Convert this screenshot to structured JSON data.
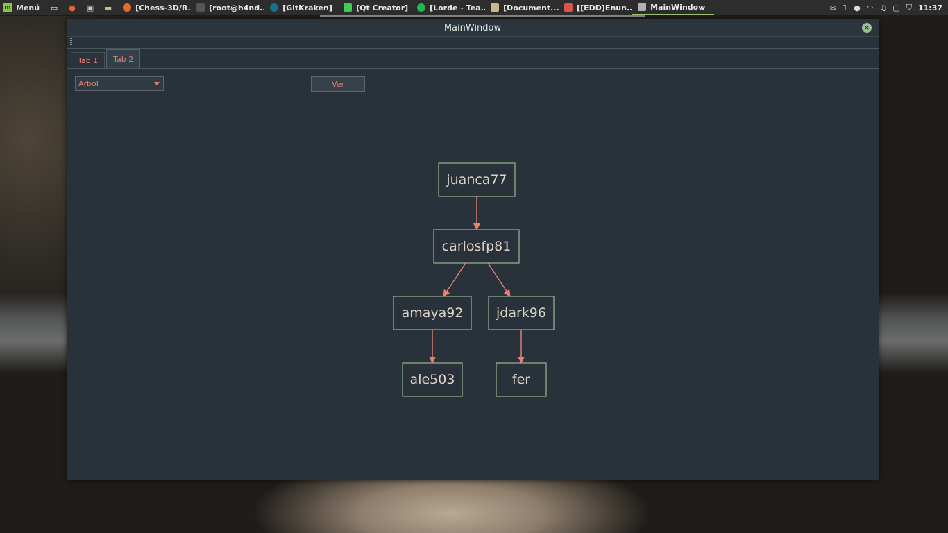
{
  "panel": {
    "menu_label": "Menú",
    "tasks": [
      {
        "label": "[Chess-3D/R...",
        "icon": "firefox-icon",
        "color": "#e8692b"
      },
      {
        "label": "[root@h4nd...",
        "icon": "terminal-icon",
        "color": "#555555"
      },
      {
        "label": "[GitKraken]",
        "icon": "gitkraken-icon",
        "color": "#1a6f8a"
      },
      {
        "label": "[Qt Creator]",
        "icon": "qt-icon",
        "color": "#41cd52"
      },
      {
        "label": "[Lorde - Tea...",
        "icon": "spotify-icon",
        "color": "#1db954"
      },
      {
        "label": "[Document...",
        "icon": "folder-icon",
        "color": "#c9b98f"
      },
      {
        "label": "[[EDD]Enun...",
        "icon": "document-icon",
        "color": "#d9534f"
      },
      {
        "label": "MainWindow",
        "icon": "window-icon",
        "color": "#b0b0b0"
      }
    ],
    "tray": {
      "notification_count": "1",
      "clock": "11:37"
    }
  },
  "window": {
    "title": "MainWindow",
    "tabs": [
      {
        "label": "Tab 1"
      },
      {
        "label": "Tab 2"
      }
    ],
    "selected_tab": "Tab 2",
    "combo": {
      "value": "Arbol"
    },
    "ver_button": {
      "label": "Ver"
    }
  },
  "tree": {
    "nodes": [
      {
        "id": "n1",
        "label": "juanca77"
      },
      {
        "id": "n2",
        "label": "carlosfp81"
      },
      {
        "id": "n3",
        "label": "amaya92"
      },
      {
        "id": "n4",
        "label": "jdark96"
      },
      {
        "id": "n5",
        "label": "ale503"
      },
      {
        "id": "n6",
        "label": "fer"
      }
    ],
    "edges": [
      {
        "from": "n1",
        "to": "n2"
      },
      {
        "from": "n2",
        "to": "n3"
      },
      {
        "from": "n2",
        "to": "n4"
      },
      {
        "from": "n3",
        "to": "n5"
      },
      {
        "from": "n4",
        "to": "n6"
      }
    ]
  }
}
